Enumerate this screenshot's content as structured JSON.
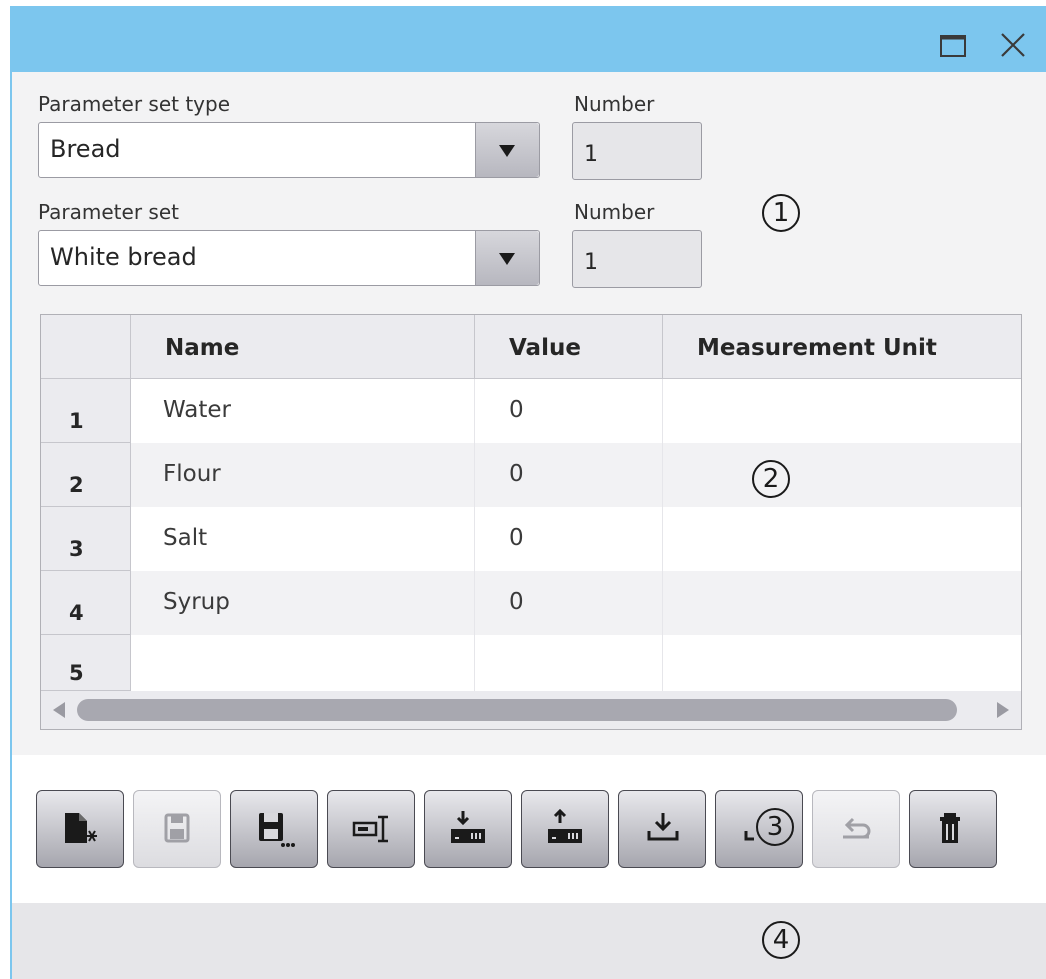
{
  "form": {
    "param_set_type_label": "Parameter set type",
    "param_set_type_value": "Bread",
    "number1_label": "Number",
    "number1_value": "1",
    "param_set_label": "Parameter set",
    "param_set_value": "White bread",
    "number2_label": "Number",
    "number2_value": "1"
  },
  "table": {
    "columns": [
      "Name",
      "Value",
      "Measurement Unit"
    ],
    "rows": [
      {
        "num": "1",
        "name": "Water",
        "value": "0",
        "unit": ""
      },
      {
        "num": "2",
        "name": "Flour",
        "value": "0",
        "unit": ""
      },
      {
        "num": "3",
        "name": "Salt",
        "value": "0",
        "unit": ""
      },
      {
        "num": "4",
        "name": "Syrup",
        "value": "0",
        "unit": ""
      },
      {
        "num": "5",
        "name": "",
        "value": "",
        "unit": ""
      }
    ]
  },
  "callouts": [
    "1",
    "2",
    "3",
    "4"
  ],
  "toolbar": {
    "buttons": [
      {
        "icon": "new-file-icon",
        "enabled": true
      },
      {
        "icon": "save-icon",
        "enabled": false
      },
      {
        "icon": "save-as-icon",
        "enabled": true
      },
      {
        "icon": "rename-icon",
        "enabled": true
      },
      {
        "icon": "read-from-plc-icon",
        "enabled": true
      },
      {
        "icon": "write-to-plc-icon",
        "enabled": true
      },
      {
        "icon": "import-icon",
        "enabled": true
      },
      {
        "icon": "export-icon",
        "enabled": true
      },
      {
        "icon": "undo-icon",
        "enabled": false
      },
      {
        "icon": "delete-icon",
        "enabled": true
      }
    ]
  },
  "colors": {
    "titlebar": "#7cc6ee",
    "panel": "#f3f3f4",
    "statusbar": "#e6e6e9"
  }
}
